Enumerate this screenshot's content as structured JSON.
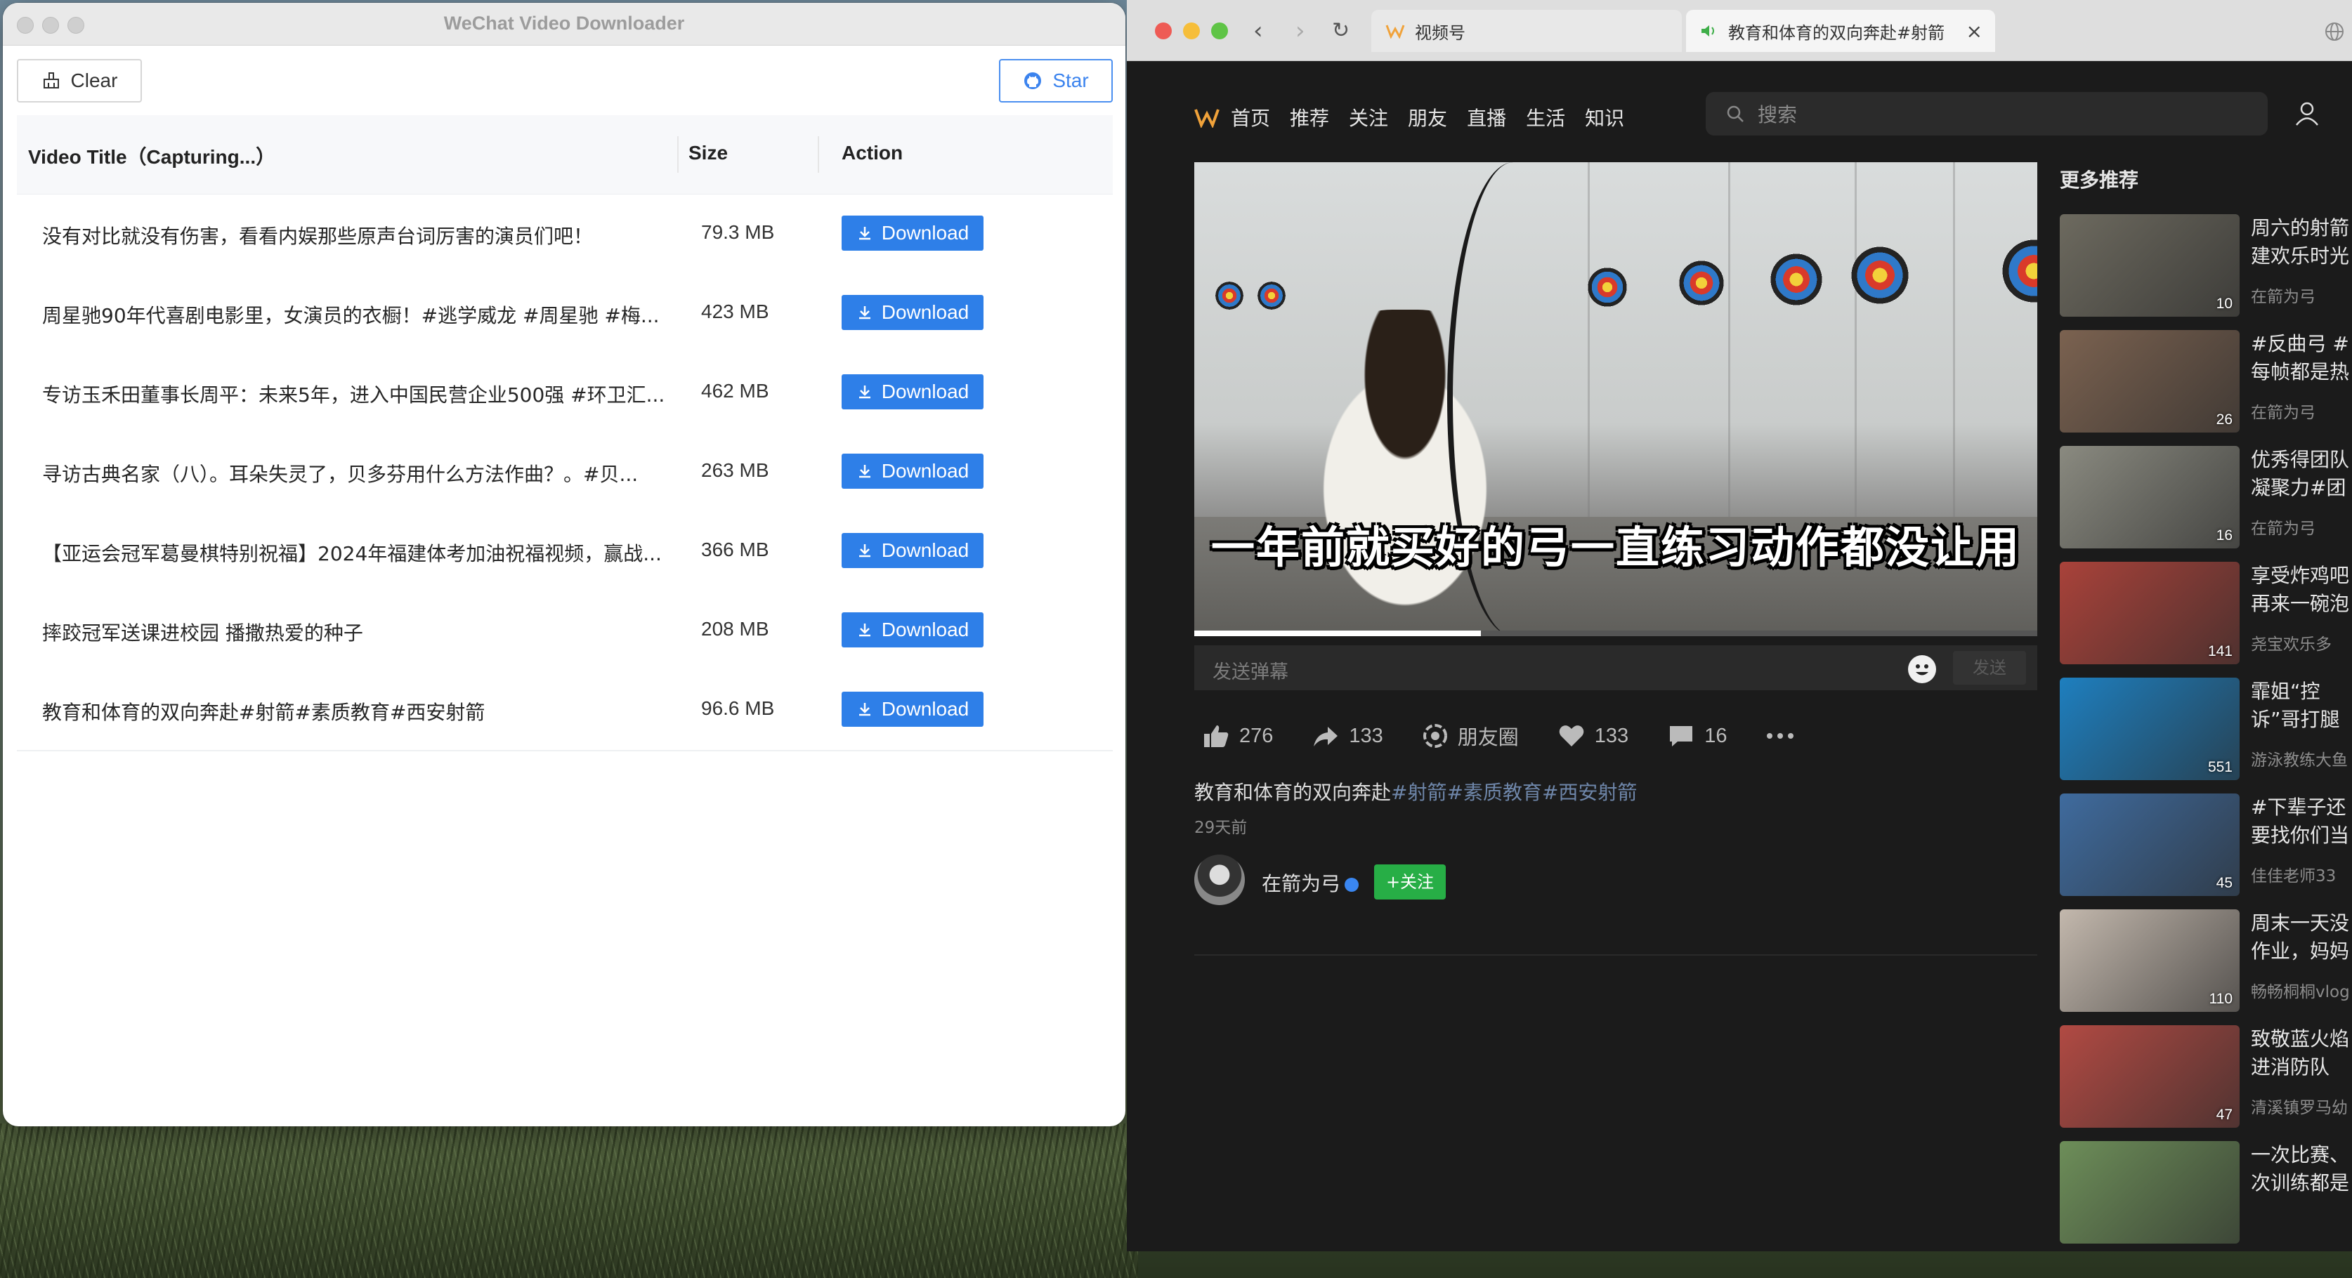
{
  "downloader": {
    "window_title": "WeChat Video Downloader",
    "clear_label": "Clear",
    "star_label": "Star",
    "columns": {
      "title": "Video Title（Capturing...）",
      "size": "Size",
      "action": "Action"
    },
    "rows": [
      {
        "title": "没有对比就没有伤害，看看内娱那些原声台词厉害的演员们吧！",
        "size": "79.3 MB",
        "action": "Download"
      },
      {
        "title": "周星驰90年代喜剧电影里，女演员的衣橱！#逃学威龙 #周星驰 #梅...",
        "size": "423 MB",
        "action": "Download"
      },
      {
        "title": "专访玉禾田董事长周平：未来5年，进入中国民营企业500强 #环卫汇...",
        "size": "462 MB",
        "action": "Download"
      },
      {
        "title": "寻访古典名家（八）。耳朵失灵了，贝多芬用什么方法作曲？。#贝...",
        "size": "263 MB",
        "action": "Download"
      },
      {
        "title": "【亚运会冠军葛曼棋特别祝福】2024年福建体考加油祝福视频，赢战...",
        "size": "366 MB",
        "action": "Download"
      },
      {
        "title": "摔跤冠军送课进校园 播撒热爱的种子",
        "size": "208 MB",
        "action": "Download"
      },
      {
        "title": "教育和体育的双向奔赴#射箭#素质教育#西安射箭",
        "size": "96.6 MB",
        "action": "Download"
      }
    ]
  },
  "browser": {
    "tabs": [
      {
        "label": "视频号"
      },
      {
        "label": "教育和体育的双向奔赴#射箭#"
      }
    ],
    "nav": [
      "首页",
      "推荐",
      "关注",
      "朋友",
      "直播",
      "生活",
      "知识"
    ],
    "search_placeholder": "搜索",
    "video": {
      "subtitle": "一年前就买好的弓一直练习动作都没让用",
      "progress": 0.34
    },
    "danmu_placeholder": "发送弹幕",
    "send_label": "发送",
    "stats": {
      "likes": "276",
      "shares": "133",
      "moments": "朋友圈",
      "hearts": "133",
      "comments": "16"
    },
    "description": {
      "text": "教育和体育的双向奔赴",
      "tags": "#射箭#素质教育#西安射箭"
    },
    "date": "29天前",
    "author": "在箭为弓",
    "follow_label": "+关注",
    "recommendations_title": "更多推荐",
    "recommendations": [
      {
        "title": "周六的射箭建欢乐时光",
        "author": "在箭为弓",
        "likes": "10",
        "color": "#6d6a5f"
      },
      {
        "title": "#反曲弓 #每帧都是热爱",
        "author": "在箭为弓",
        "likes": "26",
        "color": "#7b6250"
      },
      {
        "title": "优秀得团队凝聚力#团",
        "author": "在箭为弓",
        "likes": "16",
        "color": "#8a8a80"
      },
      {
        "title": "享受炸鸡吧再来一碗泡",
        "author": "尧宝欢乐多",
        "likes": "141",
        "color": "#a9423a"
      },
      {
        "title": "霏姐“控诉”哥打腿训练",
        "author": "游泳教练大鱼",
        "likes": "551",
        "color": "#1e7fbf"
      },
      {
        "title": "#下辈子还要找你们当爸",
        "author": "佳佳老师33",
        "likes": "45",
        "color": "#3f6b9e"
      },
      {
        "title": "周末一天没作业，妈妈",
        "author": "畅畅桐桐vlog",
        "likes": "110",
        "color": "#c3b8ad"
      },
      {
        "title": "致敬蓝火焰进消防队",
        "author": "清溪镇罗马幼",
        "likes": "47",
        "color": "#b14a43"
      },
      {
        "title": "一次比赛、次训练都是",
        "author": "",
        "likes": "",
        "color": "#6d8e59"
      }
    ]
  }
}
